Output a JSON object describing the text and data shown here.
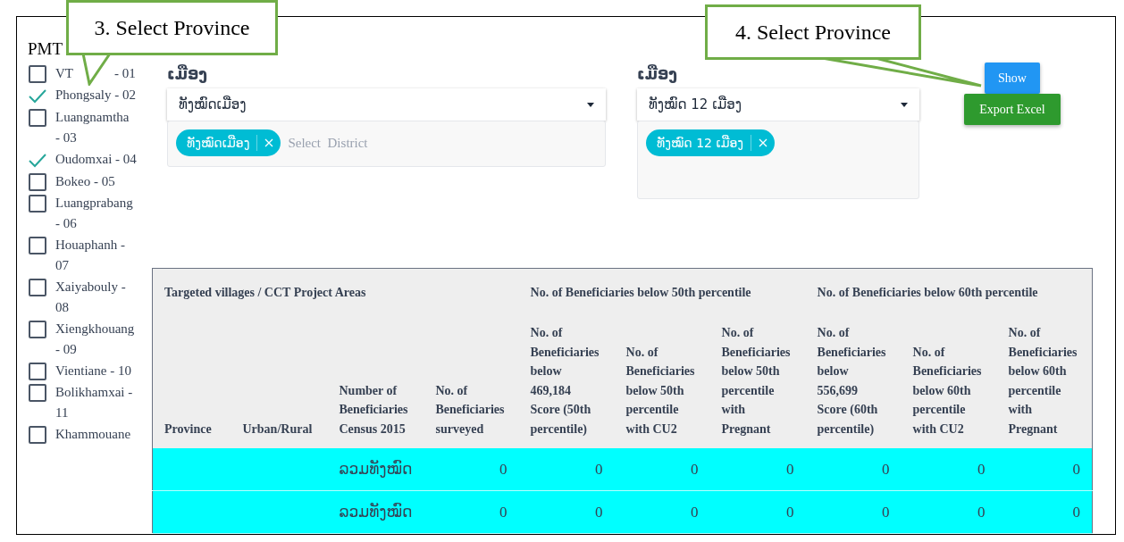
{
  "sidebar": {
    "title": "PMT",
    "provinces": [
      {
        "label": "VT",
        "label_end": "- 01",
        "checked": false
      },
      {
        "label": "Phongsaly - 02",
        "checked": true
      },
      {
        "label": "Luangnamtha - 03",
        "checked": false
      },
      {
        "label": "Oudomxai - 04",
        "checked": true
      },
      {
        "label": "Bokeo - 05",
        "checked": false
      },
      {
        "label": "Luangprabang - 06",
        "checked": false
      },
      {
        "label": "Houaphanh - 07",
        "checked": false
      },
      {
        "label": "Xaiyabouly - 08",
        "checked": false
      },
      {
        "label": "Xiengkhouang - 09",
        "checked": false
      },
      {
        "label": "Vientiane - 10",
        "checked": false
      },
      {
        "label": "Bolikhamxai - 11",
        "checked": false
      },
      {
        "label": "Khammouane",
        "checked": false
      }
    ]
  },
  "filters": [
    {
      "label": "ເມືອງ",
      "value": "ທັງໝົດເມືອງ",
      "tags": [
        "ທັງໝົດເມືອງ"
      ],
      "placeholder": "Select  District"
    },
    {
      "label": "ເມືອງ",
      "value": "ທັງໝົດ 12 ເມືອງ",
      "tags": [
        "ທັງໝົດ 12 ເມືອງ"
      ]
    }
  ],
  "buttons": [
    {
      "label": "Show",
      "kind": "primary"
    },
    {
      "label": "Export Excel",
      "kind": "success"
    }
  ],
  "table": {
    "group_headers": [
      {
        "label": "Targeted villages / CCT Project Areas"
      },
      {
        "label": "No. of Beneficiaries below 50th percentile"
      },
      {
        "label": "No. of Beneficiaries below 60th percentile"
      }
    ],
    "columns": [
      "Province",
      "Urban/Rural",
      "Number of Beneficiaries Census 2015",
      "No. of Beneficiaries surveyed",
      "No. of Beneficiaries below 469,184 Score (50th percentile)",
      "No. of Beneficiaries below 50th percentile with CU2",
      "No. of Beneficiaries below 50th percentile with Pregnant",
      "No. of Beneficiaries below 556,699 Score (60th percentile)",
      "No. of Beneficiaries below 60th percentile with CU2",
      "No. of Beneficiaries below 60th percentile with Pregnant"
    ],
    "rows": [
      {
        "cells": [
          "",
          "",
          "ລວມທັງໝົດ",
          "0",
          "0",
          "0",
          "0",
          "0",
          "0",
          "0"
        ]
      },
      {
        "cells": [
          "",
          "",
          "ລວມທັງໝົດ",
          "0",
          "0",
          "0",
          "0",
          "0",
          "0",
          "0"
        ]
      }
    ]
  },
  "callouts": [
    {
      "text": "3. Select Province"
    },
    {
      "text": "4. Select Province"
    }
  ]
}
